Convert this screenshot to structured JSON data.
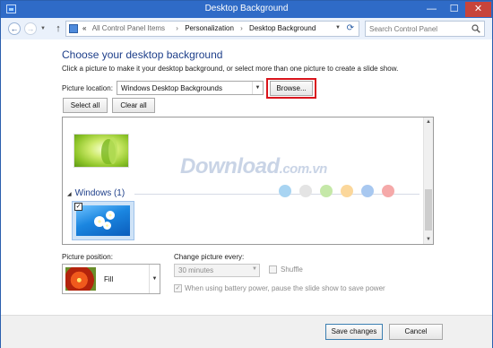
{
  "window": {
    "title": "Desktop Background",
    "buttons": {
      "minimize": "—",
      "maximize": "☐",
      "close": "✕"
    }
  },
  "navbar": {
    "back_icon": "←",
    "forward_icon": "→",
    "up_icon": "↑",
    "breadcrumb": {
      "overflow": "«",
      "items": [
        "All Control Panel Items",
        "Personalization",
        "Desktop Background"
      ],
      "separator": "›"
    },
    "search": {
      "placeholder": "Search Control Panel"
    }
  },
  "main": {
    "heading": "Choose your desktop background",
    "subtitle": "Click a picture to make it your desktop background, or select more than one picture to create a slide show.",
    "location": {
      "label": "Picture location:",
      "value": "Windows Desktop Backgrounds",
      "browse_label": "Browse..."
    },
    "select_all_label": "Select all",
    "clear_all_label": "Clear all",
    "picture_list": {
      "group_name": "Windows (1)",
      "checkmark": "✓"
    },
    "watermark": {
      "text": "Download",
      "suffix": ".com.vn",
      "dot_colors": [
        "#a8d4f2",
        "#e4e4e4",
        "#c5e8a8",
        "#fbd79b",
        "#a8c8f0",
        "#f5a9a9"
      ]
    },
    "position": {
      "label": "Picture position:",
      "value": "Fill"
    },
    "slideshow": {
      "change_label": "Change picture every:",
      "interval_value": "30 minutes",
      "shuffle_label": "Shuffle",
      "battery_label": "When using battery power, pause the slide show to save power"
    }
  },
  "footer": {
    "save_label": "Save changes",
    "cancel_label": "Cancel"
  },
  "colors": {
    "title_bar": "#2f6bc7",
    "heading": "#1e3f8a",
    "highlight_border": "#d9141c"
  }
}
